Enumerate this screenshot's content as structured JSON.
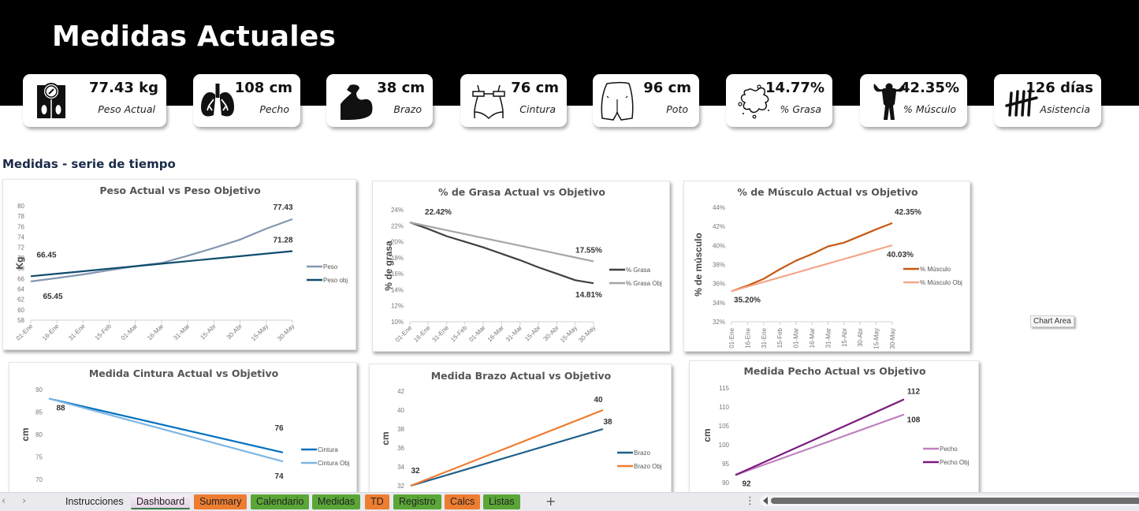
{
  "header": {
    "title": "Medidas Actuales"
  },
  "kpis": [
    {
      "id": "peso",
      "value": "77.43 kg",
      "label": "Peso Actual",
      "icon": "scale-icon"
    },
    {
      "id": "pecho",
      "value": "108 cm",
      "label": "Pecho",
      "icon": "lungs-icon"
    },
    {
      "id": "brazo",
      "value": "38 cm",
      "label": "Brazo",
      "icon": "biceps-icon"
    },
    {
      "id": "cintura",
      "value": "76 cm",
      "label": "Cintura",
      "icon": "waist-tape-icon"
    },
    {
      "id": "poto",
      "value": "96 cm",
      "label": "Poto",
      "icon": "buttocks-icon"
    },
    {
      "id": "grasa",
      "value": "14.77%",
      "label": "% Grasa",
      "icon": "fat-splash-icon"
    },
    {
      "id": "musculo",
      "value": "42.35%",
      "label": "% Músculo",
      "icon": "bodybuilder-icon"
    },
    {
      "id": "asistencia",
      "value": "126 días",
      "label": "Asistencia",
      "icon": "tally-marks-icon"
    }
  ],
  "section": {
    "title": "Medidas - serie de tiempo"
  },
  "tooltip": {
    "text": "Chart Area"
  },
  "chart_data": [
    {
      "id": "peso",
      "type": "line",
      "title": "Peso Actual vs Peso Objetivo",
      "ylabel": "Kg",
      "x": [
        "01-Ene",
        "16-Ene",
        "31-Ene",
        "15-Feb",
        "01-Mar",
        "16-Mar",
        "31-Mar",
        "15-Abr",
        "30-Abr",
        "15-May",
        "30-May"
      ],
      "ylim": [
        58,
        80
      ],
      "yticks": [
        58,
        60,
        62,
        64,
        66,
        68,
        70,
        72,
        74,
        76,
        78,
        80
      ],
      "ytick_format": "int",
      "series": [
        {
          "name": "Peso",
          "color": "#8497b0",
          "values": [
            65.45,
            66.1,
            66.8,
            67.6,
            68.4,
            69.0,
            70.4,
            71.9,
            73.5,
            75.6,
            77.43
          ]
        },
        {
          "name": "Peso obj",
          "color": "#0f4c6e",
          "values": [
            66.45,
            66.93,
            67.41,
            67.9,
            68.38,
            68.86,
            69.35,
            69.83,
            70.31,
            70.8,
            71.28
          ]
        }
      ],
      "annotations": [
        "66.45",
        "65.45",
        "77.43",
        "71.28"
      ],
      "legend": "right"
    },
    {
      "id": "grasa",
      "type": "line",
      "title": "% de Grasa Actual vs Objetivo",
      "ylabel": "% de grasa",
      "x": [
        "01-Ene",
        "16-Ene",
        "31-Ene",
        "15-Feb",
        "01-Mar",
        "16-Mar",
        "31-Mar",
        "15-Abr",
        "30-Abr",
        "15-May",
        "30-May"
      ],
      "ylim": [
        10,
        24
      ],
      "yticks": [
        10,
        12,
        14,
        16,
        18,
        20,
        22,
        24
      ],
      "ytick_format": "pct",
      "series": [
        {
          "name": "% Grasa",
          "color": "#404040",
          "values": [
            22.42,
            21.6,
            20.7,
            20.0,
            19.3,
            18.5,
            17.7,
            16.8,
            16.0,
            15.2,
            14.81
          ]
        },
        {
          "name": "% Grasa Obj",
          "color": "#a6a6a6",
          "values": [
            22.42,
            21.93,
            21.45,
            20.96,
            20.47,
            19.99,
            19.5,
            19.01,
            18.52,
            18.04,
            17.55
          ]
        }
      ],
      "annotations": [
        "22.42%",
        "17.55%",
        "14.81%"
      ],
      "legend": "right"
    },
    {
      "id": "musculo",
      "type": "line",
      "title": "% de Músculo Actual vs Objetivo",
      "ylabel": "% de músculo",
      "x": [
        "01-Ene",
        "16-Ene",
        "31-Ene",
        "15-Feb",
        "01-Mar",
        "16-Mar",
        "31-Mar",
        "15-Abr",
        "30-Abr",
        "15-May",
        "30-May"
      ],
      "ylim": [
        32,
        44
      ],
      "yticks": [
        32,
        34,
        36,
        38,
        40,
        42,
        44
      ],
      "ytick_format": "pct",
      "series": [
        {
          "name": "% Músculo",
          "color": "#c55a11",
          "values": [
            35.2,
            35.8,
            36.5,
            37.5,
            38.4,
            39.1,
            39.9,
            40.3,
            41.0,
            41.7,
            42.35
          ]
        },
        {
          "name": "% Músculo Obj",
          "color": "#f4a58a",
          "values": [
            35.2,
            35.68,
            36.17,
            36.65,
            37.13,
            37.62,
            38.1,
            38.58,
            39.06,
            39.55,
            40.03
          ]
        }
      ],
      "annotations": [
        "42.35%",
        "40.03%",
        "35.20%"
      ],
      "legend": "right"
    },
    {
      "id": "cintura",
      "type": "line",
      "title": "Medida Cintura Actual vs Objetivo",
      "ylabel": "cm",
      "ylim": [
        70,
        90
      ],
      "yticks": [
        70,
        75,
        80,
        85,
        90
      ],
      "ytick_format": "int",
      "series": [
        {
          "name": "Cintura",
          "color": "#0070c0",
          "values": [
            88,
            76
          ]
        },
        {
          "name": "Cintura Obj",
          "color": "#7eb6e3",
          "values": [
            88,
            74
          ]
        }
      ],
      "annotations": [
        "88",
        "76",
        "74"
      ],
      "legend": "right"
    },
    {
      "id": "brazo",
      "type": "line",
      "title": "Medida Brazo Actual vs Objetivo",
      "ylabel": "cm",
      "ylim": [
        32,
        42
      ],
      "yticks": [
        32,
        34,
        36,
        38,
        40,
        42
      ],
      "ytick_format": "int",
      "series": [
        {
          "name": "Brazo",
          "color": "#1f5f8b",
          "values": [
            32,
            38
          ]
        },
        {
          "name": "Brazo Obj",
          "color": "#ed7d31",
          "values": [
            32,
            40
          ]
        }
      ],
      "annotations": [
        "32",
        "40",
        "38"
      ],
      "legend": "right"
    },
    {
      "id": "pecho",
      "type": "line",
      "title": "Medida Pecho Actual vs Objetivo",
      "ylabel": "cm",
      "ylim": [
        90,
        115
      ],
      "yticks": [
        90,
        95,
        100,
        105,
        110,
        115
      ],
      "ytick_format": "int",
      "series": [
        {
          "name": "Pecho",
          "color": "#c081c0",
          "values": [
            92,
            108
          ]
        },
        {
          "name": "Pecho Obj",
          "color": "#7b1a7e",
          "values": [
            92,
            112
          ]
        }
      ],
      "annotations": [
        "92",
        "112",
        "108"
      ],
      "legend": "right"
    }
  ],
  "tabbar": {
    "nav_prev": "‹",
    "nav_next": "›",
    "tabs": [
      {
        "label": "Instrucciones",
        "style": "plain"
      },
      {
        "label": "Dashboard",
        "style": "active"
      },
      {
        "label": "Summary",
        "style": "orange"
      },
      {
        "label": "Calendario",
        "style": "green"
      },
      {
        "label": "Medidas",
        "style": "green"
      },
      {
        "label": "TD",
        "style": "orange"
      },
      {
        "label": "Registro",
        "style": "green"
      },
      {
        "label": "Calcs",
        "style": "orange"
      },
      {
        "label": "Listas",
        "style": "green"
      }
    ],
    "add_label": "+",
    "more_label": "⋮"
  }
}
